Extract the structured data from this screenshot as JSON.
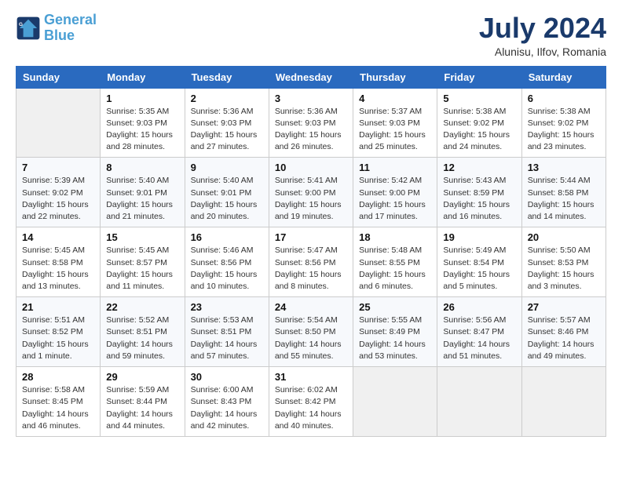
{
  "header": {
    "logo_line1": "General",
    "logo_line2": "Blue",
    "month": "July 2024",
    "location": "Alunisu, Ilfov, Romania"
  },
  "weekdays": [
    "Sunday",
    "Monday",
    "Tuesday",
    "Wednesday",
    "Thursday",
    "Friday",
    "Saturday"
  ],
  "weeks": [
    [
      {
        "day": "",
        "info": ""
      },
      {
        "day": "1",
        "info": "Sunrise: 5:35 AM\nSunset: 9:03 PM\nDaylight: 15 hours\nand 28 minutes."
      },
      {
        "day": "2",
        "info": "Sunrise: 5:36 AM\nSunset: 9:03 PM\nDaylight: 15 hours\nand 27 minutes."
      },
      {
        "day": "3",
        "info": "Sunrise: 5:36 AM\nSunset: 9:03 PM\nDaylight: 15 hours\nand 26 minutes."
      },
      {
        "day": "4",
        "info": "Sunrise: 5:37 AM\nSunset: 9:03 PM\nDaylight: 15 hours\nand 25 minutes."
      },
      {
        "day": "5",
        "info": "Sunrise: 5:38 AM\nSunset: 9:02 PM\nDaylight: 15 hours\nand 24 minutes."
      },
      {
        "day": "6",
        "info": "Sunrise: 5:38 AM\nSunset: 9:02 PM\nDaylight: 15 hours\nand 23 minutes."
      }
    ],
    [
      {
        "day": "7",
        "info": "Sunrise: 5:39 AM\nSunset: 9:02 PM\nDaylight: 15 hours\nand 22 minutes."
      },
      {
        "day": "8",
        "info": "Sunrise: 5:40 AM\nSunset: 9:01 PM\nDaylight: 15 hours\nand 21 minutes."
      },
      {
        "day": "9",
        "info": "Sunrise: 5:40 AM\nSunset: 9:01 PM\nDaylight: 15 hours\nand 20 minutes."
      },
      {
        "day": "10",
        "info": "Sunrise: 5:41 AM\nSunset: 9:00 PM\nDaylight: 15 hours\nand 19 minutes."
      },
      {
        "day": "11",
        "info": "Sunrise: 5:42 AM\nSunset: 9:00 PM\nDaylight: 15 hours\nand 17 minutes."
      },
      {
        "day": "12",
        "info": "Sunrise: 5:43 AM\nSunset: 8:59 PM\nDaylight: 15 hours\nand 16 minutes."
      },
      {
        "day": "13",
        "info": "Sunrise: 5:44 AM\nSunset: 8:58 PM\nDaylight: 15 hours\nand 14 minutes."
      }
    ],
    [
      {
        "day": "14",
        "info": "Sunrise: 5:45 AM\nSunset: 8:58 PM\nDaylight: 15 hours\nand 13 minutes."
      },
      {
        "day": "15",
        "info": "Sunrise: 5:45 AM\nSunset: 8:57 PM\nDaylight: 15 hours\nand 11 minutes."
      },
      {
        "day": "16",
        "info": "Sunrise: 5:46 AM\nSunset: 8:56 PM\nDaylight: 15 hours\nand 10 minutes."
      },
      {
        "day": "17",
        "info": "Sunrise: 5:47 AM\nSunset: 8:56 PM\nDaylight: 15 hours\nand 8 minutes."
      },
      {
        "day": "18",
        "info": "Sunrise: 5:48 AM\nSunset: 8:55 PM\nDaylight: 15 hours\nand 6 minutes."
      },
      {
        "day": "19",
        "info": "Sunrise: 5:49 AM\nSunset: 8:54 PM\nDaylight: 15 hours\nand 5 minutes."
      },
      {
        "day": "20",
        "info": "Sunrise: 5:50 AM\nSunset: 8:53 PM\nDaylight: 15 hours\nand 3 minutes."
      }
    ],
    [
      {
        "day": "21",
        "info": "Sunrise: 5:51 AM\nSunset: 8:52 PM\nDaylight: 15 hours\nand 1 minute."
      },
      {
        "day": "22",
        "info": "Sunrise: 5:52 AM\nSunset: 8:51 PM\nDaylight: 14 hours\nand 59 minutes."
      },
      {
        "day": "23",
        "info": "Sunrise: 5:53 AM\nSunset: 8:51 PM\nDaylight: 14 hours\nand 57 minutes."
      },
      {
        "day": "24",
        "info": "Sunrise: 5:54 AM\nSunset: 8:50 PM\nDaylight: 14 hours\nand 55 minutes."
      },
      {
        "day": "25",
        "info": "Sunrise: 5:55 AM\nSunset: 8:49 PM\nDaylight: 14 hours\nand 53 minutes."
      },
      {
        "day": "26",
        "info": "Sunrise: 5:56 AM\nSunset: 8:47 PM\nDaylight: 14 hours\nand 51 minutes."
      },
      {
        "day": "27",
        "info": "Sunrise: 5:57 AM\nSunset: 8:46 PM\nDaylight: 14 hours\nand 49 minutes."
      }
    ],
    [
      {
        "day": "28",
        "info": "Sunrise: 5:58 AM\nSunset: 8:45 PM\nDaylight: 14 hours\nand 46 minutes."
      },
      {
        "day": "29",
        "info": "Sunrise: 5:59 AM\nSunset: 8:44 PM\nDaylight: 14 hours\nand 44 minutes."
      },
      {
        "day": "30",
        "info": "Sunrise: 6:00 AM\nSunset: 8:43 PM\nDaylight: 14 hours\nand 42 minutes."
      },
      {
        "day": "31",
        "info": "Sunrise: 6:02 AM\nSunset: 8:42 PM\nDaylight: 14 hours\nand 40 minutes."
      },
      {
        "day": "",
        "info": ""
      },
      {
        "day": "",
        "info": ""
      },
      {
        "day": "",
        "info": ""
      }
    ]
  ]
}
